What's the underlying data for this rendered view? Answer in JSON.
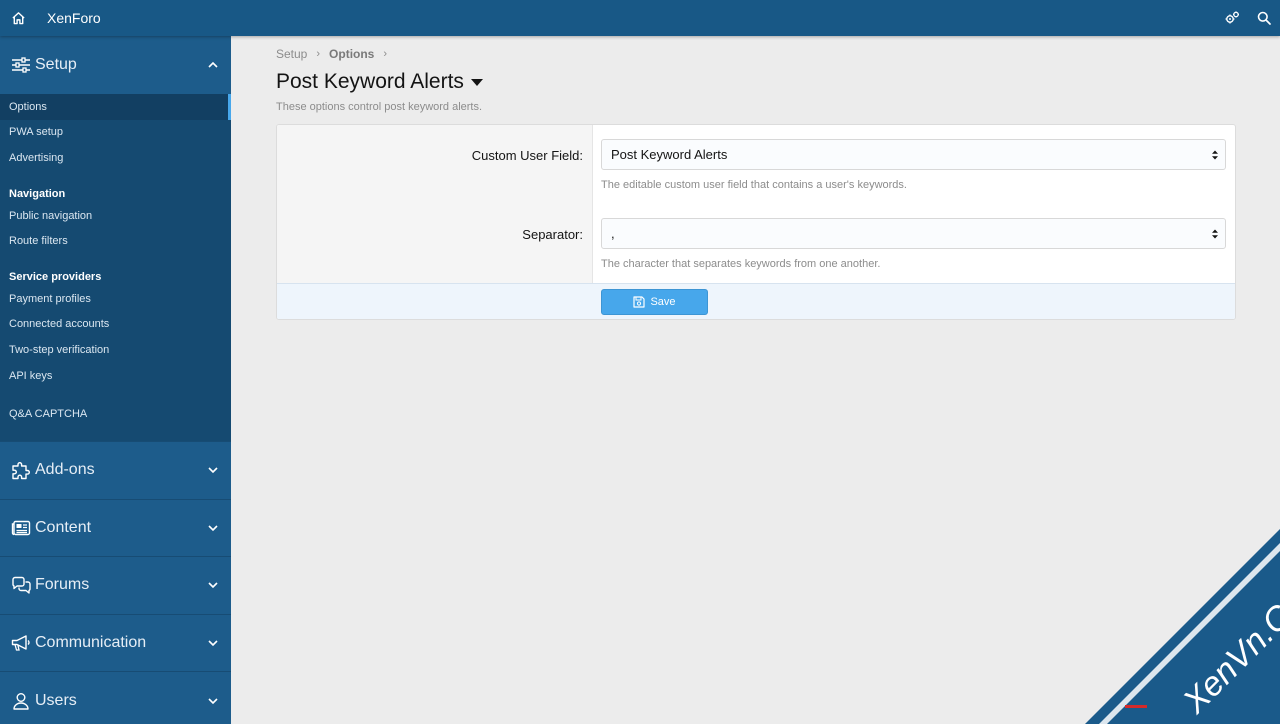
{
  "app": {
    "brand": "XenForo"
  },
  "topbar": {
    "home_icon": "home-icon",
    "settings_icon": "gears-icon",
    "search_icon": "search-icon"
  },
  "sidebar": {
    "setup": {
      "label": "Setup",
      "items": [
        {
          "label": "Options",
          "active": true
        },
        {
          "label": "PWA setup"
        },
        {
          "label": "Advertising"
        }
      ],
      "navigation_heading": "Navigation",
      "navigation_items": [
        {
          "label": "Public navigation"
        },
        {
          "label": "Route filters"
        }
      ],
      "service_heading": "Service providers",
      "service_items": [
        {
          "label": "Payment profiles"
        },
        {
          "label": "Connected accounts"
        },
        {
          "label": "Two-step verification"
        },
        {
          "label": "API keys"
        }
      ],
      "extra_item": "Q&A CAPTCHA"
    },
    "sections": [
      {
        "label": "Add-ons",
        "icon": "puzzle-icon"
      },
      {
        "label": "Content",
        "icon": "newspaper-icon"
      },
      {
        "label": "Forums",
        "icon": "comments-icon"
      },
      {
        "label": "Communication",
        "icon": "megaphone-icon"
      },
      {
        "label": "Users",
        "icon": "user-icon"
      }
    ]
  },
  "breadcrumb": {
    "items": [
      "Setup",
      "Options"
    ]
  },
  "page": {
    "title": "Post Keyword Alerts",
    "description": "These options control post keyword alerts."
  },
  "form": {
    "fields": [
      {
        "label": "Custom User Field:",
        "value": "Post Keyword Alerts",
        "hint": "The editable custom user field that contains a user's keywords."
      },
      {
        "label": "Separator:",
        "value": ",",
        "hint": "The character that separates keywords from one another."
      }
    ],
    "save_label": "Save"
  },
  "watermark": {
    "text": "XenVn.Com"
  },
  "colors": {
    "header": "#185886",
    "sidebar": "#1d5c8b",
    "sidebar_panel": "#154a71",
    "accent": "#47a7eb",
    "watermark": "#1a5a8a"
  }
}
